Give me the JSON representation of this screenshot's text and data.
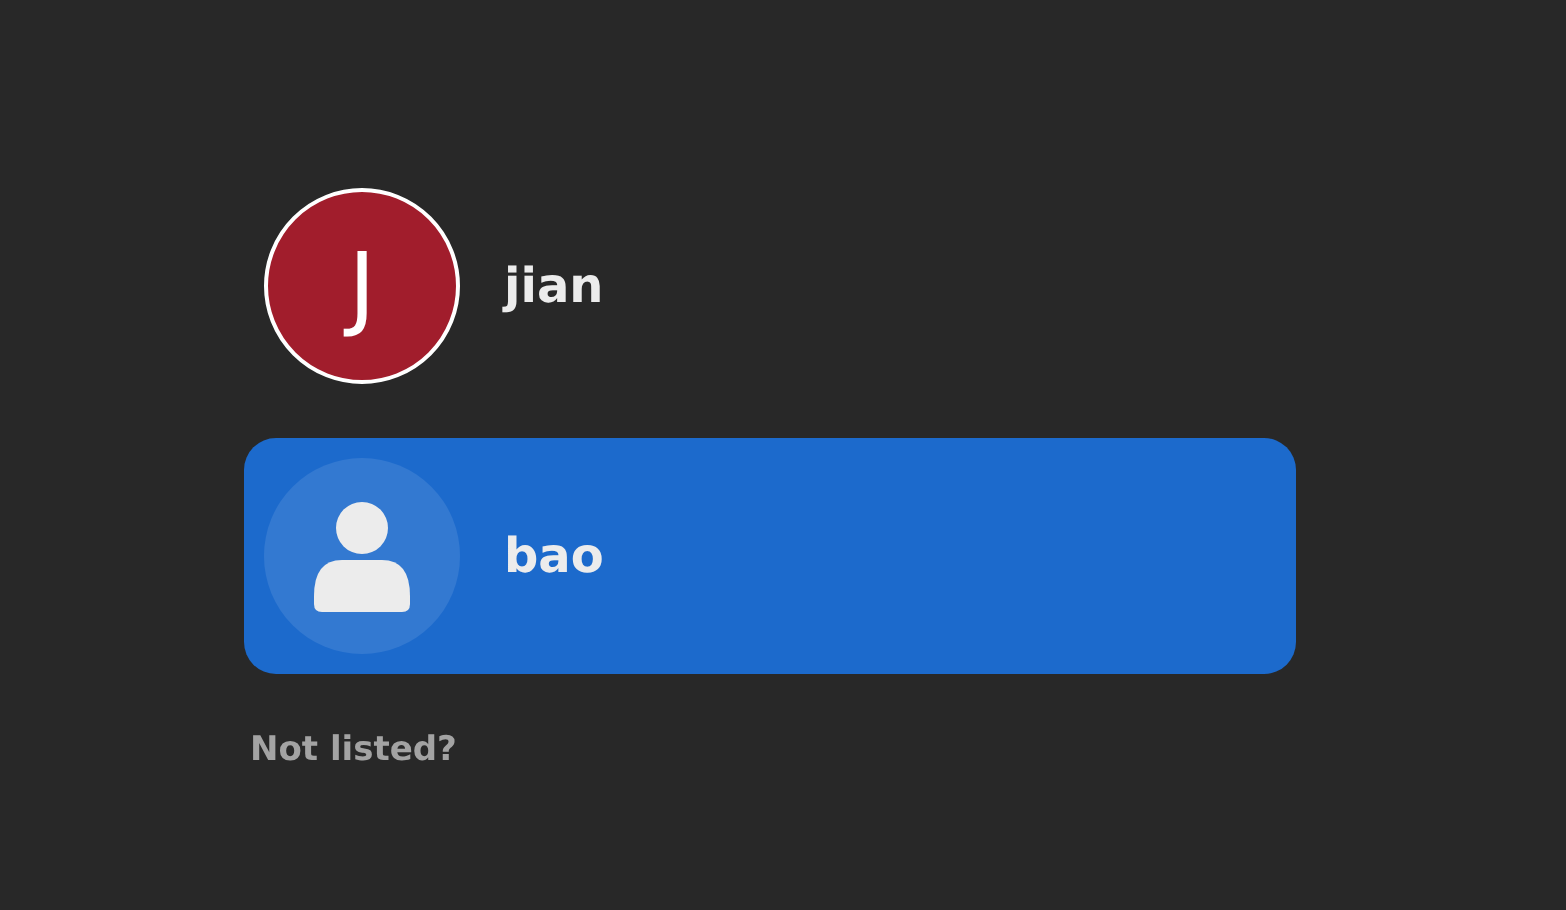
{
  "users": [
    {
      "name": "jian",
      "selected": false,
      "avatar": {
        "kind": "initial",
        "initial": "J",
        "color": "#a11d2c"
      }
    },
    {
      "name": "bao",
      "selected": true,
      "avatar": {
        "kind": "generic"
      }
    }
  ],
  "not_listed_link": "Not listed?"
}
